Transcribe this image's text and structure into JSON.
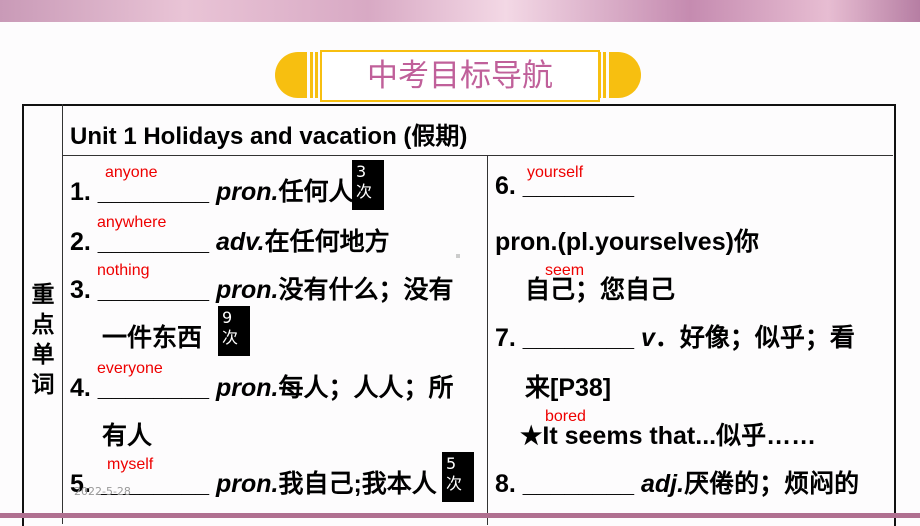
{
  "title": "中考目标导航",
  "side_label": "重点单词",
  "header": "Unit 1     Holidays and vacation (假期)",
  "left": [
    {
      "num": "1. ________",
      "pos": "pron.",
      "def": "任何人",
      "answer": "anyone",
      "badge": "3次"
    },
    {
      "num": "2. ________",
      "pos": "adv.",
      "def": "在任何地方",
      "answer": "anywhere"
    },
    {
      "num": "3. ________",
      "pos": "pron.",
      "def": "没有什么；没有",
      "answer": "nothing"
    },
    {
      "cont": "一件东西",
      "badge": "9次"
    },
    {
      "num": "4. ________",
      "pos": "pron.",
      "def": "每人；人人；所",
      "answer": "everyone"
    },
    {
      "cont": "有人"
    },
    {
      "num": "5. ________",
      "pos": "pron.",
      "def": "我自己;我本人",
      "answer": "myself",
      "badge": "5次"
    }
  ],
  "right": [
    {
      "num": "6. ________",
      "answer": "yourself"
    },
    {
      "text": "pron.(pl.yourselves)你"
    },
    {
      "text": "自己；您自己",
      "answer": "seem"
    },
    {
      "num": "7. ________",
      "pos": "v",
      "def": "．好像；似乎；看"
    },
    {
      "text": "来[P38]"
    },
    {
      "text": "★It seems that...似乎……",
      "answer": "bored"
    },
    {
      "num": "8. ________",
      "pos": "adj.",
      "def": "厌倦的；烦闷的"
    }
  ],
  "date": "2022-5-28",
  "colors": {
    "title": "#c0609a",
    "accent": "#f7bf10",
    "answer": "#ee0000"
  }
}
